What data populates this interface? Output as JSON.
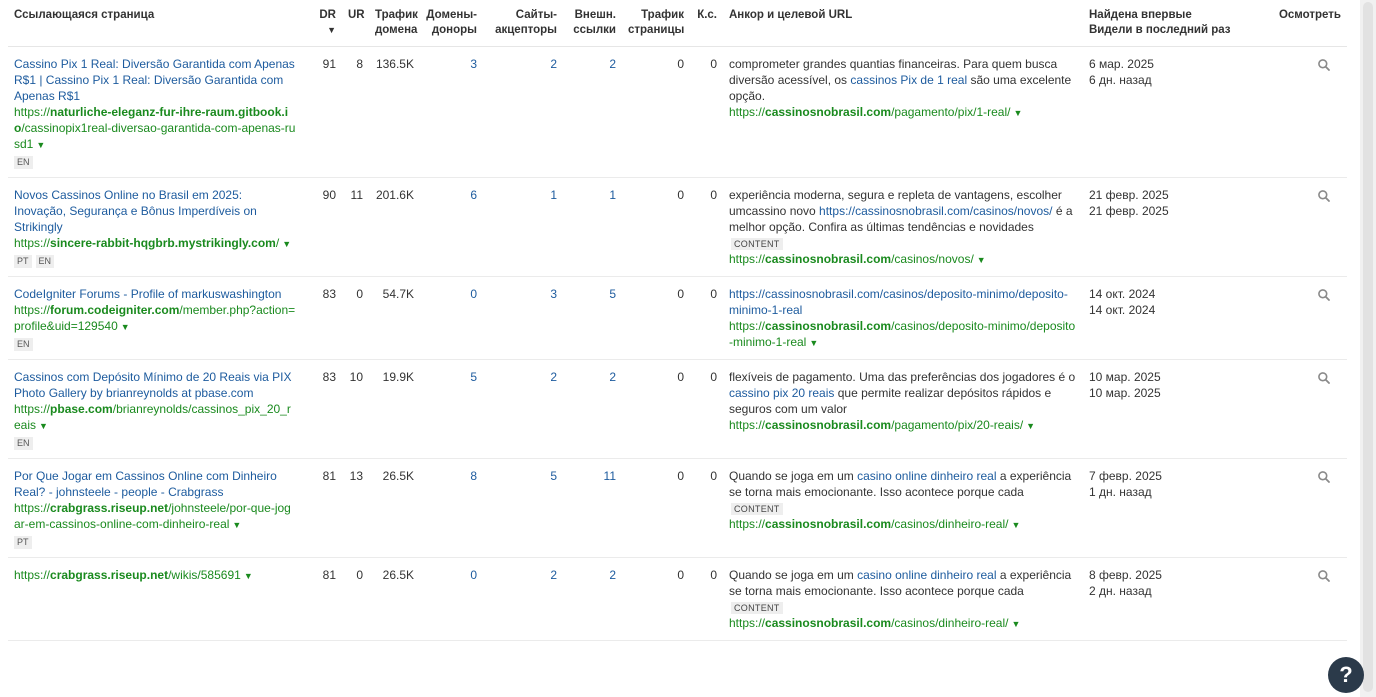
{
  "columns": {
    "referring_page": "Ссылающаяся страница",
    "dr": "DR",
    "ur": "UR",
    "domain_traffic_1": "Трафик",
    "domain_traffic_2": "домена",
    "ref_domains_1": "Домены-",
    "ref_domains_2": "доноры",
    "linked_domains_1": "Сайты-",
    "linked_domains_2": "акцепторы",
    "ext_links_1": "Внешн.",
    "ext_links_2": "ссылки",
    "page_traffic_1": "Трафик",
    "page_traffic_2": "страницы",
    "kw": "К.с.",
    "anchor": "Анкор и целевой URL",
    "found_1": "Найдена впервые",
    "found_2": "Видели в последний раз",
    "inspect": "Осмотреть"
  },
  "rows": [
    {
      "title": "Cassino Pix 1 Real: Diversão Garantida com Apenas R$1 | Cassino Pix 1 Real: Diversão Garantida com Apenas R$1",
      "url_prefix": "https://",
      "url_domain": "naturliche-eleganz-fur-ihre-raum.gitbook.io",
      "url_path": "/cassinopix1real-diversao-garantida-com-apenas-rusd1",
      "langs": [
        "EN"
      ],
      "dr": "91",
      "ur": "8",
      "traffic": "136.5K",
      "ref_domains": "3",
      "linked_domains": "2",
      "ext_links": "2",
      "page_traffic": "0",
      "kw": "0",
      "anchor_before": "comprometer grandes quantias financeiras. Para quem busca diversão acessível, os ",
      "anchor_link": "cassinos Pix de 1 real",
      "anchor_after": " são uma excelente opção.",
      "content_tag": "",
      "target_prefix": "https://",
      "target_domain": "cassinosnobrasil.com",
      "target_path": "/pagamento/pix/1-real/",
      "first_seen": "6 мар. 2025",
      "last_seen": "6 дн. назад"
    },
    {
      "title": "Novos Cassinos Online no Brasil em 2025: Inovação, Segurança e Bônus Imperdíveis on Strikingly",
      "url_prefix": "https://",
      "url_domain": "sincere-rabbit-hqgbrb.mystrikingly.com",
      "url_path": "/",
      "langs": [
        "PT",
        "EN"
      ],
      "dr": "90",
      "ur": "11",
      "traffic": "201.6K",
      "ref_domains": "6",
      "linked_domains": "1",
      "ext_links": "1",
      "page_traffic": "0",
      "kw": "0",
      "anchor_before": "experiência moderna, segura e repleta de vantagens, escolher umcassino novo ",
      "anchor_link": "https://cassinosnobrasil.com/casinos/novos/",
      "anchor_after": " é a melhor opção. Confira as últimas tendências e novidades",
      "content_tag": "CONTENT",
      "target_prefix": "https://",
      "target_domain": "cassinosnobrasil.com",
      "target_path": "/casinos/novos/",
      "first_seen": "21 февр. 2025",
      "last_seen": "21 февр. 2025"
    },
    {
      "title": "CodeIgniter Forums - Profile of markuswashington",
      "url_prefix": "https://",
      "url_domain": "forum.codeigniter.com",
      "url_path": "/member.php?action=profile&uid=129540",
      "langs": [
        "EN"
      ],
      "dr": "83",
      "ur": "0",
      "traffic": "54.7K",
      "ref_domains": "0",
      "linked_domains": "3",
      "ext_links": "5",
      "page_traffic": "0",
      "kw": "0",
      "anchor_before": "",
      "anchor_link": "https://cassinosnobrasil.com/casinos/deposito-minimo/deposito-minimo-1-real",
      "anchor_after": "",
      "content_tag": "",
      "target_prefix": "https://",
      "target_domain": "cassinosnobrasil.com",
      "target_path": "/casinos/deposito-minimo/deposito-minimo-1-real",
      "first_seen": "14 окт. 2024",
      "last_seen": "14 окт. 2024"
    },
    {
      "title": "Cassinos com Depósito Mínimo de 20 Reais via PIX Photo Gallery by brianreynolds at pbase.com",
      "url_prefix": "https://",
      "url_domain": "pbase.com",
      "url_path": "/brianreynolds/cassinos_pix_20_reais",
      "langs": [
        "EN"
      ],
      "dr": "83",
      "ur": "10",
      "traffic": "19.9K",
      "ref_domains": "5",
      "linked_domains": "2",
      "ext_links": "2",
      "page_traffic": "0",
      "kw": "0",
      "anchor_before": "flexíveis de pagamento. Uma das preferências dos jogadores é o ",
      "anchor_link": "cassino pix 20 reais",
      "anchor_after": " que permite realizar depósitos rápidos e seguros com um valor",
      "content_tag": "",
      "target_prefix": "https://",
      "target_domain": "cassinosnobrasil.com",
      "target_path": "/pagamento/pix/20-reais/",
      "first_seen": "10 мар. 2025",
      "last_seen": "10 мар. 2025"
    },
    {
      "title": "Por Que Jogar em Cassinos Online com Dinheiro Real? - johnsteele - people - Crabgrass",
      "url_prefix": "https://",
      "url_domain": "crabgrass.riseup.net",
      "url_path": "/johnsteele/por-que-jogar-em-cassinos-online-com-dinheiro-real",
      "langs": [
        "PT"
      ],
      "dr": "81",
      "ur": "13",
      "traffic": "26.5K",
      "ref_domains": "8",
      "linked_domains": "5",
      "ext_links": "11",
      "page_traffic": "0",
      "kw": "0",
      "anchor_before": "Quando se joga em um ",
      "anchor_link": "casino online dinheiro real",
      "anchor_after": " a experiência se torna mais emocionante. Isso acontece porque cada",
      "content_tag": "CONTENT",
      "target_prefix": "https://",
      "target_domain": "cassinosnobrasil.com",
      "target_path": "/casinos/dinheiro-real/",
      "first_seen": "7 февр. 2025",
      "last_seen": "1 дн. назад"
    },
    {
      "title": "",
      "url_prefix": "https://",
      "url_domain": "crabgrass.riseup.net",
      "url_path": "/wikis/585691",
      "langs": [],
      "dr": "81",
      "ur": "0",
      "traffic": "26.5K",
      "ref_domains": "0",
      "linked_domains": "2",
      "ext_links": "2",
      "page_traffic": "0",
      "kw": "0",
      "anchor_before": "Quando se joga em um ",
      "anchor_link": "casino online dinheiro real",
      "anchor_after": " a experiência se torna mais emocionante. Isso acontece porque cada",
      "content_tag": "CONTENT",
      "target_prefix": "https://",
      "target_domain": "cassinosnobrasil.com",
      "target_path": "/casinos/dinheiro-real/",
      "first_seen": "8 февр. 2025",
      "last_seen": "2 дн. назад"
    }
  ],
  "icons": {
    "sort": "caret-down-icon",
    "inspect": "search-icon",
    "expand": "caret-down-icon",
    "help": "help-icon"
  },
  "help_label": "?",
  "colors": {
    "link": "#1d5b9e",
    "url": "#1a8a1e",
    "help_bg": "#2b3a4a"
  }
}
